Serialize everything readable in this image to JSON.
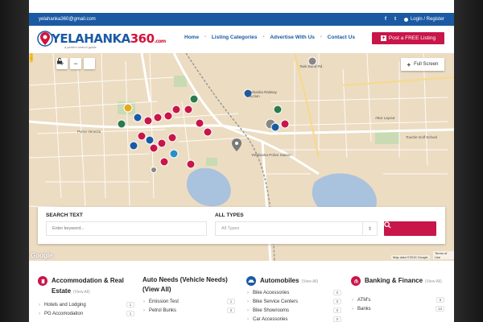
{
  "topbar": {
    "email": "yelahanka360@gmail.com",
    "facebook_icon": "f",
    "twitter_icon": "t",
    "login_label": "Login / Register"
  },
  "header": {
    "logo_brand": "YELAHANKA",
    "logo_number": "360",
    "logo_suffix": ".com",
    "logo_tagline": "a perfect search guide",
    "nav": [
      "Home",
      "Listing Categories",
      "Advertise With Us",
      "Contact Us"
    ],
    "post_button": "Post a FREE Listing"
  },
  "map": {
    "fullscreen_label": "Full Screen",
    "labels": {
      "purva": "Purva Venezia",
      "station": "Yelahanka Railway Junction",
      "police": "Yelahanka Police Station",
      "golf": "Touche Golf School",
      "tank": "Tank Bund Rd",
      "attur": "Attur Layout"
    },
    "footer_data": "Map data ©2015 Google",
    "footer_terms": "Terms of Use",
    "google_logo": "Google"
  },
  "search": {
    "text_label": "SEARCH TEXT",
    "text_placeholder": "Enter keyword...",
    "types_label": "ALL TYPES",
    "types_value": "All Types"
  },
  "categories": [
    {
      "title": "Accommodation & Real Estate",
      "view_all": "(View All)",
      "items": [
        {
          "label": "Hotels and Lodging",
          "count": "1"
        },
        {
          "label": "PG Accomodation",
          "count": "1"
        }
      ]
    },
    {
      "title": "Auto Needs (Vehicle Needs) (View All)",
      "view_all": "",
      "items": [
        {
          "label": "Emission Test",
          "count": "1"
        },
        {
          "label": "Petrol Bunks",
          "count": "0"
        }
      ]
    },
    {
      "title": "Automobiles",
      "view_all": "(View All)",
      "items": [
        {
          "label": "Bike Accessories",
          "count": "0"
        },
        {
          "label": "Bike Service Centers",
          "count": "0"
        },
        {
          "label": "Bike Showrooms",
          "count": "0"
        },
        {
          "label": "Car Accessories",
          "count": "0"
        }
      ]
    },
    {
      "title": "Banking & Finance",
      "view_all": "(View All)",
      "items": [
        {
          "label": "ATM's",
          "count": "5"
        },
        {
          "label": "Banks",
          "count": "13"
        }
      ]
    }
  ],
  "colors": {
    "brand_blue": "#1b5aa3",
    "accent_red": "#c8154a",
    "map_bg": "#ecdcc2"
  }
}
